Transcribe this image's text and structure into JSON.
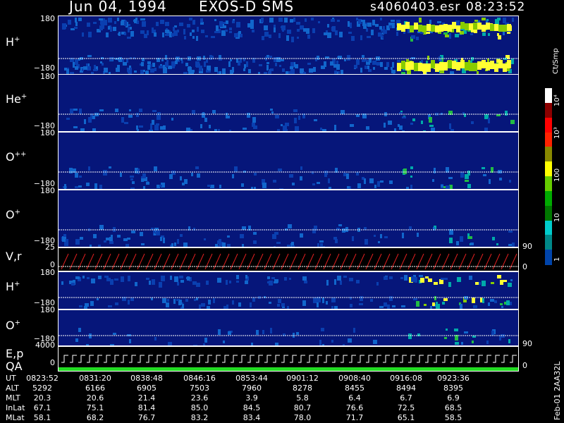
{
  "header": {
    "date": "Jun 04, 1994",
    "mission": "EXOS-D SMS",
    "file": "s4060403.esr",
    "time": "08:23:52"
  },
  "panels": [
    {
      "id": "hplus1",
      "label": "H",
      "sup": "+",
      "ymax": "180",
      "ymin": "−180"
    },
    {
      "id": "heplus",
      "label": "He",
      "sup": "+",
      "ymax": "180",
      "ymin": "−180"
    },
    {
      "id": "oplusplus",
      "label": "O",
      "sup": "++",
      "ymax": "180",
      "ymin": "−180"
    },
    {
      "id": "oplus1",
      "label": "O",
      "sup": "+",
      "ymax": "180",
      "ymin": "−180"
    },
    {
      "id": "vr",
      "label": "V,r",
      "ymax": "25",
      "ymin": "0",
      "rmax": "90",
      "rmin": "0"
    },
    {
      "id": "hplus2",
      "label": "H",
      "sup": "+",
      "ymax": "180",
      "ymin": "−180"
    },
    {
      "id": "oplus2",
      "label": "O",
      "sup": "+",
      "ymax": "180",
      "ymin": "−180",
      "rmax": "90"
    },
    {
      "id": "ep",
      "label": "E,p",
      "label2": "QA",
      "ymax": "4000",
      "ymin": "0",
      "rmin": "0"
    }
  ],
  "colorbar": {
    "unit": "Ct/Smp",
    "labels": [
      "10⁴",
      "10³",
      "100",
      "10",
      "1"
    ],
    "label_values": [
      10000,
      1000,
      100,
      10,
      1
    ],
    "colors": [
      "#ffffff",
      "#8b0000",
      "#ff0000",
      "#ff2200",
      "#888800",
      "#ffff00",
      "#66cc00",
      "#00aa00",
      "#007700",
      "#00cccc",
      "#008888",
      "#0044aa"
    ]
  },
  "footer": {
    "row_labels": [
      "UT",
      "ALT",
      "MLT",
      "InLat",
      "MLat"
    ],
    "columns": [
      {
        "ut": "0823:52",
        "alt": "5292",
        "mlt": "20.3",
        "inlat": "67.1",
        "mlat": "58.1"
      },
      {
        "ut": "0831:20",
        "alt": "6166",
        "mlt": "20.6",
        "inlat": "75.1",
        "mlat": "68.2"
      },
      {
        "ut": "0838:48",
        "alt": "6905",
        "mlt": "21.4",
        "inlat": "81.4",
        "mlat": "76.7"
      },
      {
        "ut": "0846:16",
        "alt": "7503",
        "mlt": "23.6",
        "inlat": "85.0",
        "mlat": "83.2"
      },
      {
        "ut": "0853:44",
        "alt": "7960",
        "mlt": "3.9",
        "inlat": "84.5",
        "mlat": "83.4"
      },
      {
        "ut": "0901:12",
        "alt": "8278",
        "mlt": "5.8",
        "inlat": "80.7",
        "mlat": "78.0"
      },
      {
        "ut": "0908:40",
        "alt": "8455",
        "mlt": "6.4",
        "inlat": "76.6",
        "mlat": "71.7"
      },
      {
        "ut": "0916:08",
        "alt": "8494",
        "mlt": "6.7",
        "inlat": "72.5",
        "mlat": "65.1"
      },
      {
        "ut": "0923:36",
        "alt": "8395",
        "mlt": "6.9",
        "inlat": "68.5",
        "mlat": "58.5"
      }
    ],
    "side_stamp": "Feb-01 2AA32L"
  }
}
